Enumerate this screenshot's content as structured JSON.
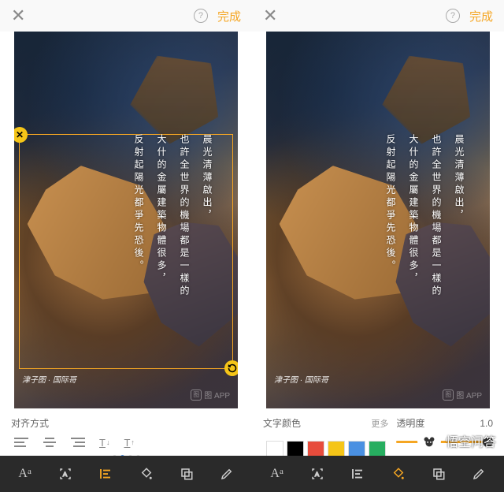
{
  "topbar": {
    "done": "完成"
  },
  "text": {
    "lines": [
      "晨光清薄啟出，",
      "也許全世界的機場都是一樣的",
      "大什的金屬建築物體很多，",
      "反射起陽光都爭先恐後。"
    ],
    "caption": "津子图 · 国际哥",
    "appmark": "图 APP"
  },
  "left": {
    "align_label": "对齐方式",
    "bottombar": [
      "Aa",
      "scan",
      "align",
      "fill",
      "layer",
      "pencil"
    ]
  },
  "right": {
    "color_label": "文字颜色",
    "more": "更多",
    "opacity_label": "透明度",
    "opacity_value": "1.0",
    "colors": [
      "#ffffff",
      "#000000",
      "#e74c3c",
      "#f5c518",
      "#4a90e2",
      "#27ae60"
    ],
    "bottombar": [
      "Aa",
      "scan",
      "align",
      "fill",
      "layer",
      "pencil"
    ]
  },
  "watermark": "悟空问答"
}
